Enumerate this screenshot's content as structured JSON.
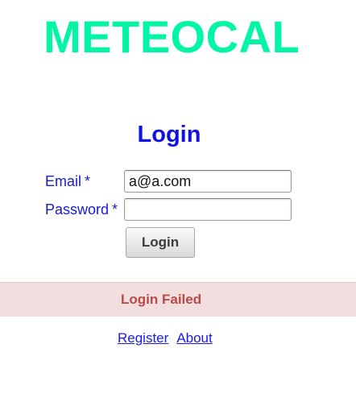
{
  "app": {
    "title": "METEOCAL",
    "title_color": "#00f5a4"
  },
  "login_form": {
    "title": "Login",
    "email": {
      "label": "Email",
      "required_mark": "*",
      "value": "a@a.com",
      "placeholder": ""
    },
    "password": {
      "label": "Password",
      "required_mark": "*",
      "value": "",
      "placeholder": ""
    },
    "submit_label": "Login"
  },
  "message": {
    "text": "Login Failed",
    "type": "error",
    "background_color": "#f2dede",
    "text_color": "#b94a48"
  },
  "footer": {
    "links": [
      {
        "label": "Register"
      },
      {
        "label": "About"
      }
    ]
  },
  "colors": {
    "heading": "#1010e0",
    "label": "#1a1ac8",
    "link": "#1a1ae6"
  }
}
